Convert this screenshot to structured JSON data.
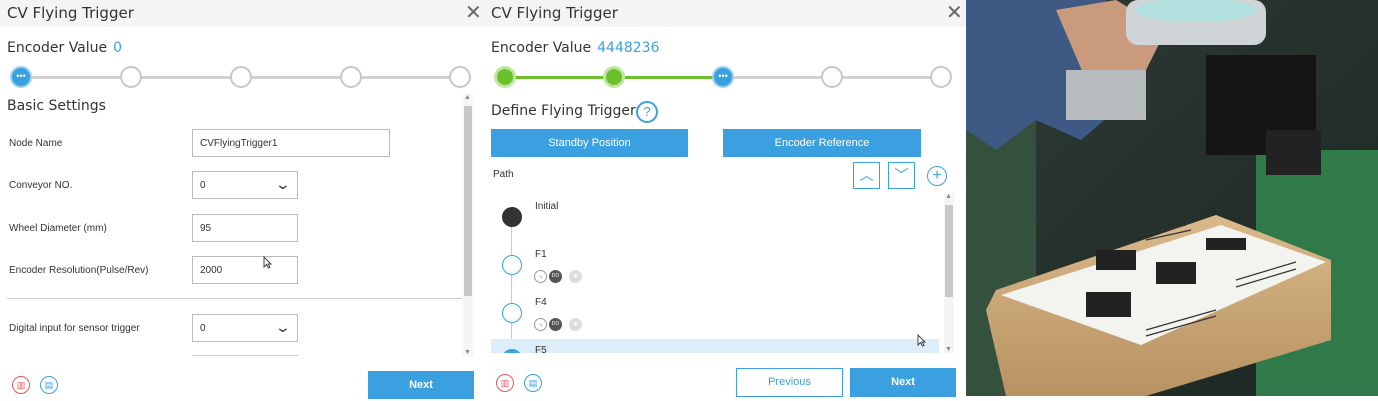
{
  "left_panel": {
    "title": "CV Flying Trigger",
    "encoder_label": "Encoder Value",
    "encoder_value": "0",
    "section_title": "Basic Settings",
    "fields": [
      {
        "label": "Node Name",
        "value": "CVFlyingTrigger1"
      },
      {
        "label": "Conveyor NO.",
        "value": "0"
      },
      {
        "label": "Wheel Diameter (mm)",
        "value": "95"
      },
      {
        "label": "Encoder Resolution(Pulse/Rev)",
        "value": "2000"
      },
      {
        "label": "Digital input for sensor trigger",
        "value": "0"
      }
    ],
    "next_label": "Next"
  },
  "right_panel": {
    "title": "CV Flying Trigger",
    "encoder_label": "Encoder Value",
    "encoder_value": "4448236",
    "section_title": "Define Flying Trigger",
    "standby_label": "Standby Position",
    "encoder_ref_label": "Encoder Reference",
    "path_label": "Path",
    "path_items": [
      {
        "label": "Initial"
      },
      {
        "label": "F1",
        "badges": [
          "DO"
        ]
      },
      {
        "label": "F4",
        "badges": [
          "DO"
        ]
      },
      {
        "label": "F5"
      }
    ],
    "previous_label": "Previous",
    "next_label": "Next"
  },
  "icons": {
    "close": "close-icon",
    "step_active": "ellipsis-icon",
    "help": "question-icon",
    "delete": "trash-icon",
    "save": "save-icon"
  },
  "colors": {
    "accent": "#3aa0e0",
    "done": "#6cc02c",
    "danger": "#e05a5a"
  }
}
